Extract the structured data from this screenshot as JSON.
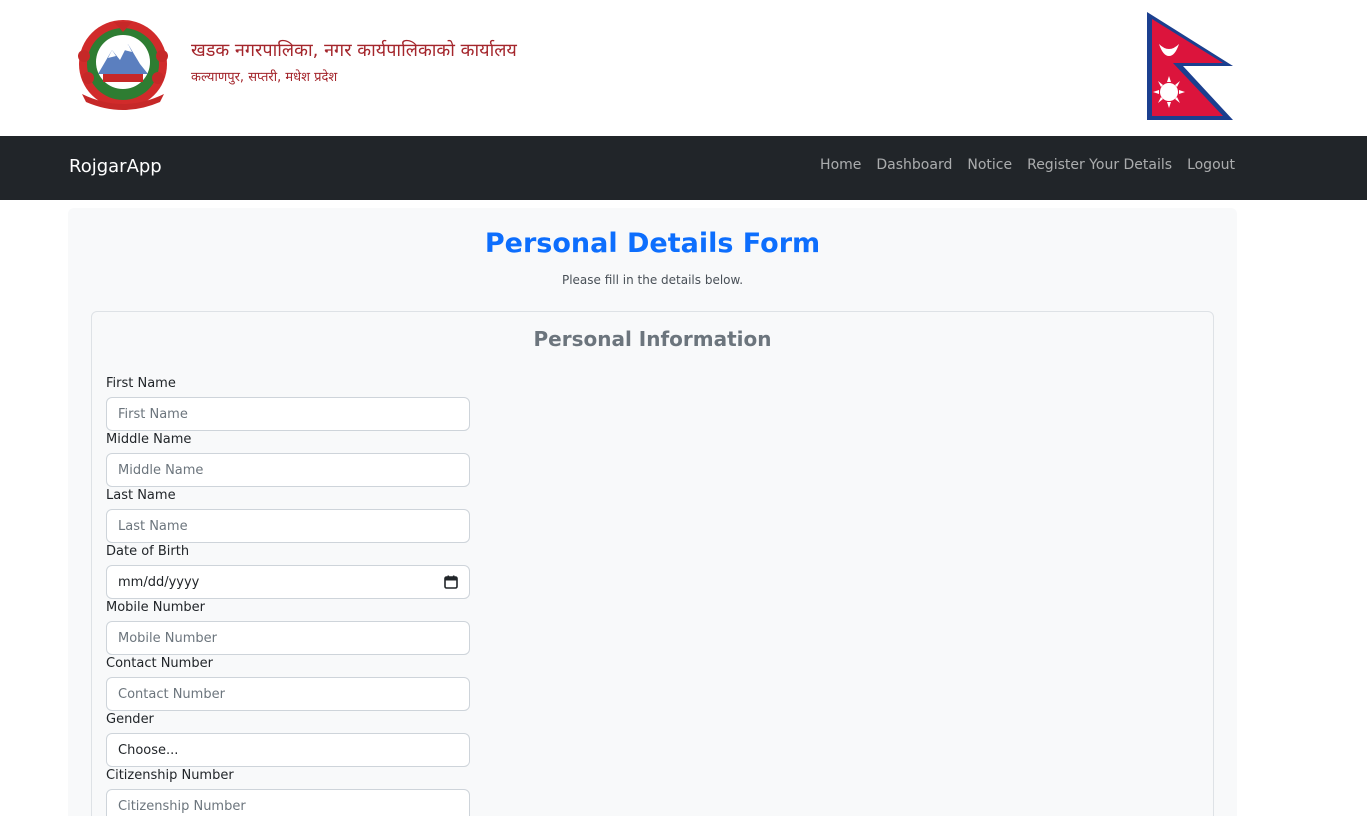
{
  "header": {
    "office_title": "खडक नगरपालिका, नगर कार्यपालिकाको कार्यालय",
    "office_address": "कल्याणपुर, सप्तरी, मधेश प्रदेश",
    "emblem_icon": "nepal-government-emblem-icon",
    "flag_icon": "nepal-flag-icon"
  },
  "navbar": {
    "brand": "RojgarApp",
    "links": [
      {
        "label": "Home"
      },
      {
        "label": "Dashboard"
      },
      {
        "label": "Notice"
      },
      {
        "label": "Register Your Details"
      },
      {
        "label": "Logout"
      }
    ]
  },
  "form": {
    "title": "Personal Details Form",
    "subtitle": "Please fill in the details below.",
    "section_title": "Personal Information",
    "fields": {
      "first_name": {
        "label": "First Name",
        "placeholder": "First Name"
      },
      "middle_name": {
        "label": "Middle Name",
        "placeholder": "Middle Name"
      },
      "last_name": {
        "label": "Last Name",
        "placeholder": "Last Name"
      },
      "dob": {
        "label": "Date of Birth",
        "value": "mm/dd/yyyy"
      },
      "mobile": {
        "label": "Mobile Number",
        "placeholder": "Mobile Number"
      },
      "contact": {
        "label": "Contact Number",
        "placeholder": "Contact Number"
      },
      "gender": {
        "label": "Gender",
        "value": "Choose..."
      },
      "citizenship": {
        "label": "Citizenship Number",
        "placeholder": "Citizenship Number"
      }
    }
  },
  "colors": {
    "accent": "#0d6efd",
    "navbar_bg": "#212529",
    "header_text": "#a4262c",
    "page_bg": "#f8f9fa"
  }
}
